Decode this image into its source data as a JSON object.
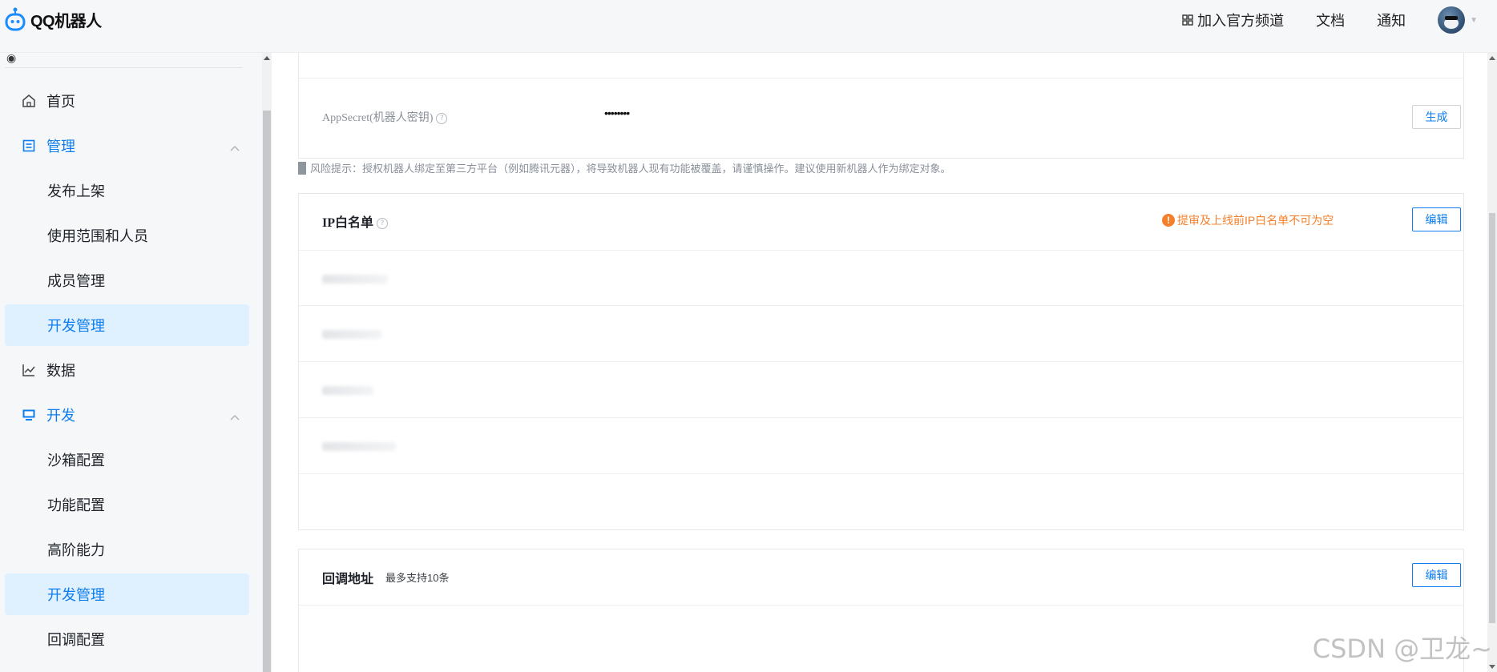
{
  "app": {
    "name": "QQ机器人"
  },
  "topnav": {
    "join_channel": "加入官方频道",
    "docs": "文档",
    "notify": "通知"
  },
  "sidebar": {
    "items": [
      {
        "label": "首页",
        "icon": "home-icon"
      },
      {
        "label": "管理",
        "icon": "manage-icon"
      },
      {
        "label": "发布上架"
      },
      {
        "label": "使用范围和人员"
      },
      {
        "label": "成员管理"
      },
      {
        "label": "开发管理"
      },
      {
        "label": "数据",
        "icon": "chart-icon"
      },
      {
        "label": "开发",
        "icon": "monitor-icon"
      },
      {
        "label": "沙箱配置"
      },
      {
        "label": "功能配置"
      },
      {
        "label": "高阶能力"
      },
      {
        "label": "开发管理"
      },
      {
        "label": "回调配置"
      }
    ]
  },
  "secret": {
    "label": "AppSecret(机器人密钥)",
    "value": "••••••••",
    "button": "生成"
  },
  "risk_tip": "风险提示：授权机器人绑定至第三方平台（例如腾讯元器），将导致机器人现有功能被覆盖，请谨慎操作。建议使用新机器人作为绑定对象。",
  "ip_whitelist": {
    "title": "IP白名单",
    "warning": "提审及上线前IP白名单不可为空",
    "edit": "编辑"
  },
  "callback": {
    "title": "回调地址",
    "hint": "最多支持10条",
    "edit": "编辑"
  },
  "watermark": "CSDN @卫龙~",
  "colors": {
    "accent": "#0d7df0",
    "warning": "#f5802c",
    "active_bg": "#dff0ff"
  }
}
